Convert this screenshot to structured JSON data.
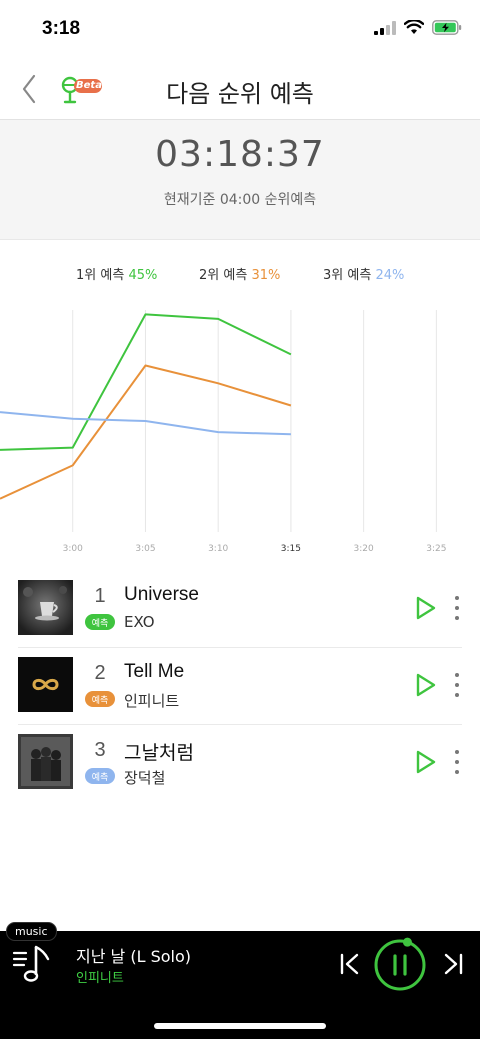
{
  "status": {
    "time": "3:18"
  },
  "nav": {
    "title": "다음 순위 예측",
    "beta": "Beta"
  },
  "timer": {
    "value": "03:18:37",
    "subtitle": "현재기준 04:00 순위예측"
  },
  "legend": [
    {
      "rank": "1위 예측",
      "pct": "45%",
      "color": "#3fc43f"
    },
    {
      "rank": "2위 예측",
      "pct": "31%",
      "color": "#e8913a"
    },
    {
      "rank": "3위 예측",
      "pct": "24%",
      "color": "#8fb5ee"
    }
  ],
  "chart_data": {
    "type": "line",
    "x": [
      "2:55",
      "3:00",
      "3:05",
      "3:10",
      "3:15"
    ],
    "xticks": [
      "3:00",
      "3:05",
      "3:10",
      "3:15",
      "3:20",
      "3:25"
    ],
    "xlim": [
      "2:55",
      "3:28"
    ],
    "ylim": [
      0,
      100
    ],
    "grid": true,
    "series": [
      {
        "name": "1위 예측",
        "color": "#3fc43f",
        "values": [
          37,
          38,
          98,
          96,
          80
        ]
      },
      {
        "name": "2위 예측",
        "color": "#e8913a",
        "values": [
          15,
          30,
          75,
          67,
          57
        ]
      },
      {
        "name": "3위 예측",
        "color": "#8fb5ee",
        "values": [
          54,
          51,
          50,
          45,
          44
        ]
      }
    ]
  },
  "songs": [
    {
      "rank": "1",
      "title": "Universe",
      "artist": "EXO",
      "badge": "예측",
      "badge_color": "#3fc43f"
    },
    {
      "rank": "2",
      "title": "Tell Me",
      "artist": "인피니트",
      "badge": "예측",
      "badge_color": "#e8913a"
    },
    {
      "rank": "3",
      "title": "그날처럼",
      "artist": "장덕철",
      "badge": "예측",
      "badge_color": "#8fb5ee"
    }
  ],
  "player": {
    "tag": "music",
    "title": "지난 날 (L Solo)",
    "artist": "인피니트",
    "progress": 0.05
  },
  "colors": {
    "accent": "#3fc43f",
    "player_bg": "#000000"
  }
}
